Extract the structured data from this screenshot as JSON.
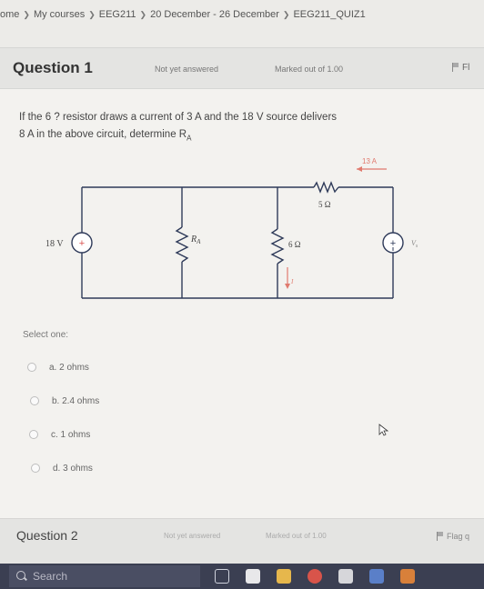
{
  "breadcrumb": {
    "items": [
      "ome",
      "My courses",
      "EEG211",
      "20 December - 26 December",
      "EEG211_QUIZ1"
    ]
  },
  "question": {
    "title": "Question 1",
    "state": "Not yet answered",
    "mark": "Marked out of 1.00",
    "flag_label": "Fl",
    "text_line1": "If the 6 ? resistor draws a current of 3 A and the 18 V source delivers",
    "text_line2": "8 A in the above circuit, determine R",
    "text_sub": "A"
  },
  "circuit": {
    "source_label": "18 V",
    "plus": "+",
    "ra_label": "R",
    "ra_sub": "A",
    "r5_label": "5 Ω",
    "r6_label": "6 Ω",
    "current_13": "13 A",
    "current_i": "I",
    "vs_label": "V",
    "vs_sub": "s",
    "colors": {
      "wire": "#2e3a59",
      "current": "#e07a6e",
      "source_plus": "#d9534f"
    }
  },
  "answer": {
    "select_one": "Select one:",
    "options": [
      "a. 2 ohms",
      "b. 2.4 ohms",
      "c. 1 ohms",
      "d. 3 ohms"
    ]
  },
  "question2": {
    "title": "Question 2",
    "state": "Not yet answered",
    "mark": "Marked out of 1.00",
    "flag_label": "Flag q"
  },
  "taskbar": {
    "search_placeholder": "Search",
    "icons": [
      "task-view-icon",
      "edge-icon",
      "file-explorer-icon",
      "chrome-icon",
      "store-icon",
      "mail-icon",
      "office-icon"
    ]
  }
}
